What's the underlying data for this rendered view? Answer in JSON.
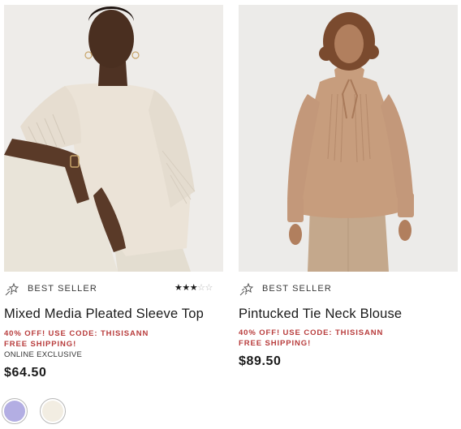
{
  "products": [
    {
      "badge": "BEST SELLER",
      "badge_icon": "shooting-star-icon",
      "rating": 3,
      "rating_max": 5,
      "title": "Mixed Media Pleated Sleeve Top",
      "promo": "40% OFF! USE CODE: THISISANN",
      "shipping": "FREE SHIPPING!",
      "exclusive": "ONLINE EXCLUSIVE",
      "price": "$64.50",
      "swatches": [
        {
          "color": "#b3aee3"
        },
        {
          "color": "#f2ede2"
        }
      ]
    },
    {
      "badge": "BEST SELLER",
      "badge_icon": "shooting-star-icon",
      "title": "Pintucked Tie Neck Blouse",
      "promo": "40% OFF! USE CODE: THISISANN",
      "shipping": "FREE SHIPPING!",
      "price": "$89.50"
    }
  ],
  "colors": {
    "promo": "#b83c3c",
    "text": "#1a1a1a",
    "photo_bg": "#eeece9",
    "blouse_left": "#ebe3d7",
    "blouse_right": "#c79d7d"
  }
}
